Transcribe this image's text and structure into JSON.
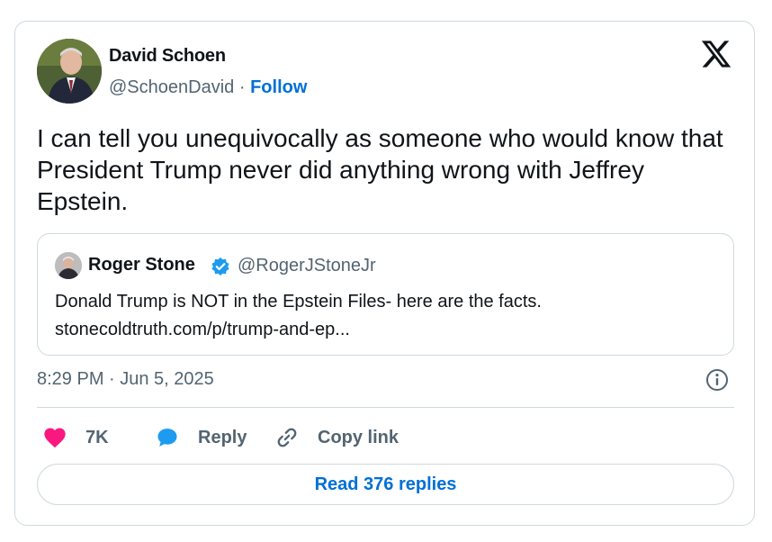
{
  "author": {
    "name": "David Schoen",
    "handle": "@SchoenDavid",
    "separator": "·",
    "follow_label": "Follow"
  },
  "tweet": {
    "text": "I can tell you unequivocally as someone who would know that President Trump never did anything wrong with Jeffrey Epstein."
  },
  "quoted": {
    "name": "Roger Stone",
    "handle": "@RogerJStoneJr",
    "text": "Donald Trump is NOT in the Epstein Files- here are the facts.",
    "link": "stonecoldtruth.com/p/trump-and-ep..."
  },
  "timestamp": "8:29 PM · Jun 5, 2025",
  "actions": {
    "like_count": "7K",
    "reply_label": "Reply",
    "copy_label": "Copy link"
  },
  "read_replies_label": "Read 376 replies",
  "colors": {
    "accent": "#006fd6",
    "like": "#f91880",
    "reply": "#1d9bf0",
    "muted": "#536471",
    "border": "#cfd9de"
  },
  "icons": [
    "x-logo-icon",
    "verified-badge-icon",
    "info-icon",
    "heart-icon",
    "reply-bubble-icon",
    "link-icon"
  ]
}
